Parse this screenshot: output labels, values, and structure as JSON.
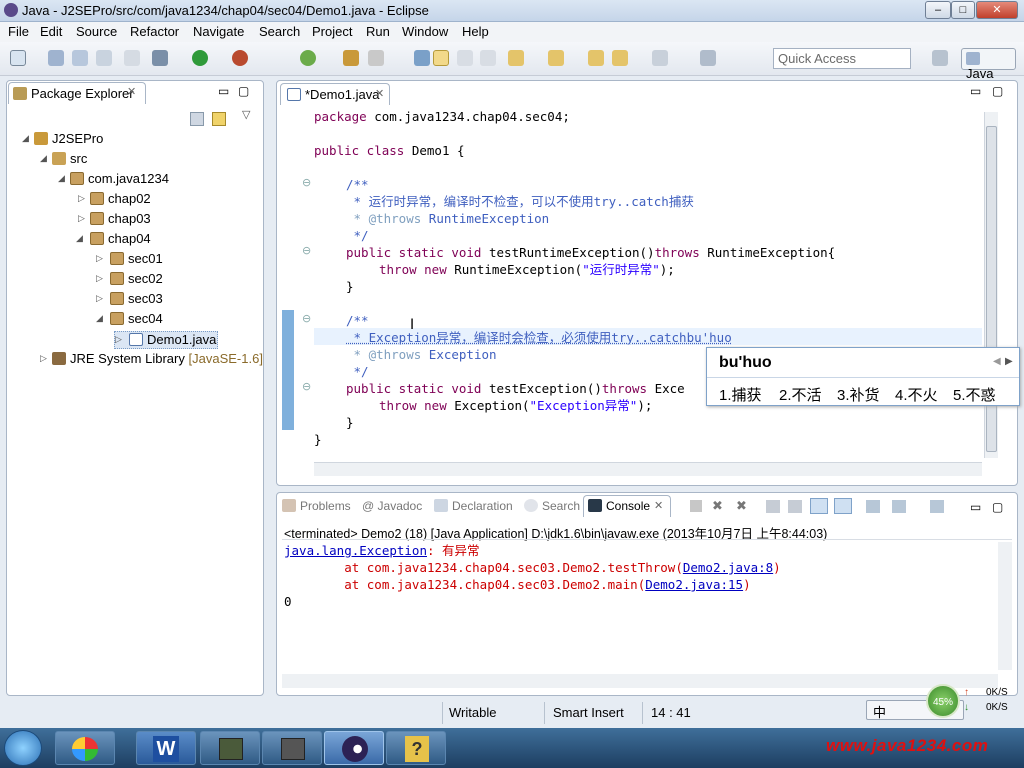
{
  "window": {
    "title": "Java - J2SEPro/src/com/java1234/chap04/sec04/Demo1.java - Eclipse",
    "controls": {
      "minimize": "–",
      "maximize": "□",
      "close": "✕"
    }
  },
  "menu": [
    "File",
    "Edit",
    "Source",
    "Refactor",
    "Navigate",
    "Search",
    "Project",
    "Run",
    "Window",
    "Help"
  ],
  "toolbar": {
    "quick_access_placeholder": "Quick Access",
    "perspective": "Java"
  },
  "package_explorer": {
    "tab": "Package Explorer",
    "tree": {
      "project": "J2SEPro",
      "src": "src",
      "package": "com.java1234",
      "chap02": "chap02",
      "chap03": "chap03",
      "chap04": "chap04",
      "sec01": "sec01",
      "sec02": "sec02",
      "sec03": "sec03",
      "sec04": "sec04",
      "file": "Demo1.java",
      "jre": "JRE System Library",
      "jre_version": "[JavaSE-1.6]"
    }
  },
  "editor": {
    "tab": "*Demo1.java",
    "lines": {
      "l1_kw": "package",
      "l1_rest": " com.java1234.chap04.sec04;",
      "l2_kw": "public class",
      "l2_rest": " Demo1 {",
      "c1_open": "/**",
      "c1_text": " * 运行时异常，编译时不检查，可以不使用try..catch捕获",
      "c1_tag": " * @throws",
      "c1_tagval": " RuntimeException",
      "c1_close": " */",
      "m1_kw": "public static void",
      "m1_rest": " testRuntimeException()",
      "m1_kw2": "throws",
      "m1_rest2": " RuntimeException{",
      "t1_kw": "throw new",
      "t1_rest": " RuntimeException(",
      "t1_str": "\"运行时异常\"",
      "t1_end": ");",
      "b1": "}",
      "c2_open": "/**",
      "c2_text": " * Exception异常，编译时会检查，必须使用try..catchbu'huo",
      "c2_tag": " * @throws",
      "c2_tagval": " Exception",
      "c2_close": " */",
      "m2_kw": "public static void",
      "m2_rest": " testException()",
      "m2_kw2": "throws",
      "m2_rest2": " Exce",
      "t2_kw": "throw new",
      "t2_rest": " Exception(",
      "t2_str": "\"Exception异常\"",
      "t2_end": ");",
      "b2": "}",
      "b3": "}"
    }
  },
  "ime": {
    "input": "bu'huo",
    "candidates": [
      "1.捕获",
      "2.不活",
      "3.补货",
      "4.不火",
      "5.不惑"
    ]
  },
  "bottom_tabs": [
    "Problems",
    "@ Javadoc",
    "Declaration",
    "Search",
    "Console"
  ],
  "console": {
    "header": "<terminated> Demo2 (18) [Java Application] D:\\jdk1.6\\bin\\javaw.exe (2013年10月7日 上午8:44:03)",
    "exc_link": "java.lang.Exception",
    "exc_msg": ": 有异常",
    "st1_pre": "        at com.java1234.chap04.sec03.Demo2.testThrow(",
    "st1_link": "Demo2.java:8",
    "st1_end": ")",
    "st2_pre": "        at com.java1234.chap04.sec03.Demo2.main(",
    "st2_link": "Demo2.java:15",
    "st2_end": ")",
    "last": "0"
  },
  "status": {
    "writable": "Writable",
    "insert": "Smart Insert",
    "position": "14 : 41"
  },
  "tray": {
    "ime_lang": "中",
    "percent": "45%",
    "up": "0K/S",
    "down": "0K/S"
  },
  "watermark": "www.java1234.com",
  "colors": {
    "keyword": "#7f0055",
    "comment": "#3f5fbf",
    "string": "#2a00ff",
    "link": "#0000c0"
  }
}
